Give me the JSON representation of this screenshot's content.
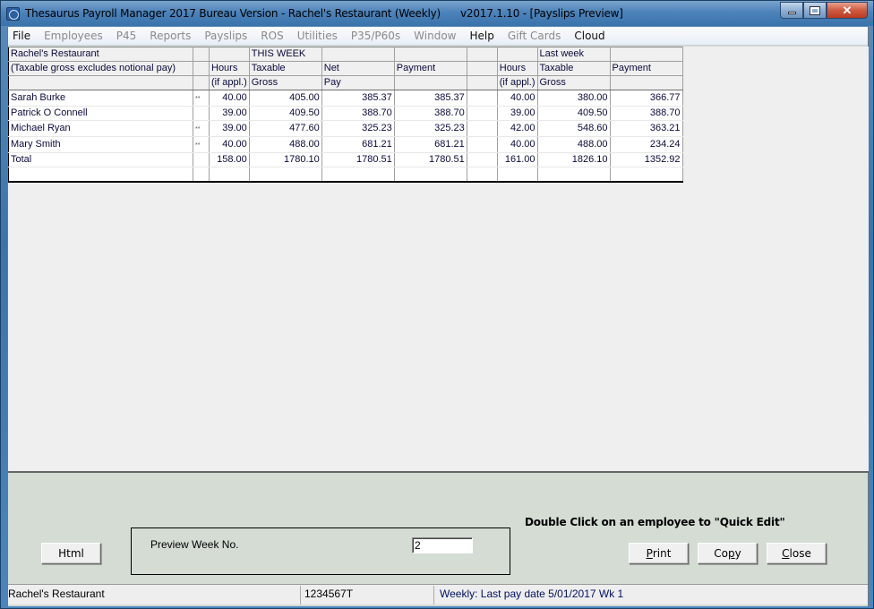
{
  "window": {
    "title": "Thesaurus Payroll Manager 2017 Bureau Version - Rachel's Restaurant (Weekly)",
    "version_view": "v2017.1.10 - [Payslips Preview]",
    "controls": {
      "minimize": "minimize",
      "maximize": "maximize",
      "close": "close"
    }
  },
  "menu": [
    {
      "label": "File",
      "enabled": true
    },
    {
      "label": "Employees",
      "enabled": false
    },
    {
      "label": "P45",
      "enabled": false
    },
    {
      "label": "Reports",
      "enabled": false
    },
    {
      "label": "Payslips",
      "enabled": false
    },
    {
      "label": "ROS",
      "enabled": false
    },
    {
      "label": "Utilities",
      "enabled": false
    },
    {
      "label": "P35/P60s",
      "enabled": false
    },
    {
      "label": "Window",
      "enabled": false
    },
    {
      "label": "Help",
      "enabled": true
    },
    {
      "label": "Gift Cards",
      "enabled": false
    },
    {
      "label": "Cloud",
      "enabled": true
    }
  ],
  "grid": {
    "header_rows": [
      [
        "Rachel's Restaurant",
        "",
        "",
        "THIS WEEK",
        "",
        "",
        "",
        "",
        "Last week",
        ""
      ],
      [
        "(Taxable gross excludes notional pay)",
        "",
        "Hours",
        "Taxable",
        "Net",
        "Payment",
        "",
        "Hours",
        "Taxable",
        "Payment"
      ],
      [
        "",
        "",
        "(if appl.)",
        "Gross",
        "Pay",
        "",
        "",
        "(if appl.)",
        "Gross",
        ""
      ]
    ],
    "rows": [
      {
        "name": "Sarah Burke",
        "mark": "**",
        "hours": "40.00",
        "taxable_gross": "405.00",
        "net_pay": "385.37",
        "payment": "385.37",
        "blank": "",
        "lw_hours": "40.00",
        "lw_taxable_gross": "380.00",
        "lw_payment": "366.77"
      },
      {
        "name": "Patrick O Connell",
        "mark": "",
        "hours": "39.00",
        "taxable_gross": "409.50",
        "net_pay": "388.70",
        "payment": "388.70",
        "blank": "",
        "lw_hours": "39.00",
        "lw_taxable_gross": "409.50",
        "lw_payment": "388.70"
      },
      {
        "name": "Michael Ryan",
        "mark": "**",
        "hours": "39.00",
        "taxable_gross": "477.60",
        "net_pay": "325.23",
        "payment": "325.23",
        "blank": "",
        "lw_hours": "42.00",
        "lw_taxable_gross": "548.60",
        "lw_payment": "363.21"
      },
      {
        "name": "Mary Smith",
        "mark": "**",
        "hours": "40.00",
        "taxable_gross": "488.00",
        "net_pay": "681.21",
        "payment": "681.21",
        "blank": "",
        "lw_hours": "40.00",
        "lw_taxable_gross": "488.00",
        "lw_payment": "234.24"
      },
      {
        "name": "Total",
        "mark": "",
        "hours": "158.00",
        "taxable_gross": "1780.10",
        "net_pay": "1780.51",
        "payment": "1780.51",
        "blank": "",
        "lw_hours": "161.00",
        "lw_taxable_gross": "1826.10",
        "lw_payment": "1352.92"
      },
      {
        "name": "",
        "mark": "",
        "hours": "",
        "taxable_gross": "",
        "net_pay": "",
        "payment": "",
        "blank": "",
        "lw_hours": "",
        "lw_taxable_gross": "",
        "lw_payment": ""
      }
    ]
  },
  "footer": {
    "hint": "Double Click on an employee to \"Quick Edit\"",
    "html_button": "Html",
    "preview_week_label": "Preview Week No.",
    "preview_week_value": "2",
    "print_button": {
      "mnemonic": "P",
      "rest": "rint"
    },
    "copy_button": {
      "pre": "Co",
      "mnemonic": "p",
      "rest": "y"
    },
    "close_button": {
      "mnemonic": "C",
      "rest": "lose"
    }
  },
  "status": {
    "company": "Rachel's Restaurant",
    "reg_number": "1234567T",
    "pay_info": "Weekly: Last pay date 5/01/2017 Wk 1"
  }
}
